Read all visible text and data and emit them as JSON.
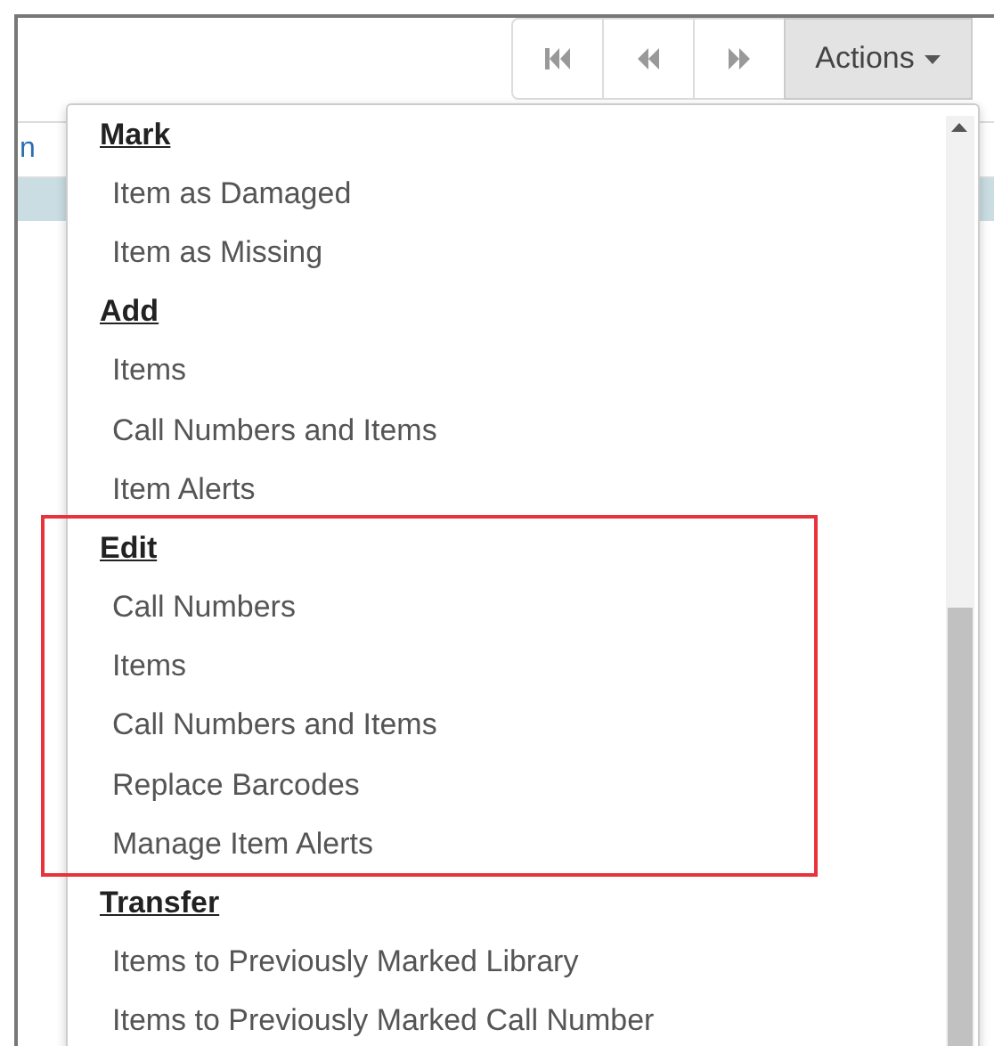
{
  "toolbar": {
    "buttons": [
      {
        "kind": "first"
      },
      {
        "kind": "previous"
      },
      {
        "kind": "next"
      }
    ],
    "actions": {
      "label": "Actions",
      "expanded": true
    }
  },
  "table": {
    "columns": [
      {
        "label": "n"
      }
    ],
    "rows": [
      {
        "selected": true
      }
    ]
  },
  "menu": {
    "groups": [
      {
        "heading": "Mark",
        "highlighted": false,
        "items": [
          "Item as Damaged",
          "Item as Missing"
        ]
      },
      {
        "heading": "Add",
        "highlighted": false,
        "items": [
          "Items",
          "Call Numbers and Items",
          "Item Alerts"
        ]
      },
      {
        "heading": "Edit",
        "highlighted": true,
        "items": [
          "Call Numbers",
          "Items",
          "Call Numbers and Items",
          "Replace Barcodes",
          "Manage Item Alerts"
        ]
      },
      {
        "heading": "Transfer",
        "highlighted": false,
        "items": [
          "Items to Previously Marked Library",
          "Items to Previously Marked Call Number"
        ]
      }
    ]
  }
}
